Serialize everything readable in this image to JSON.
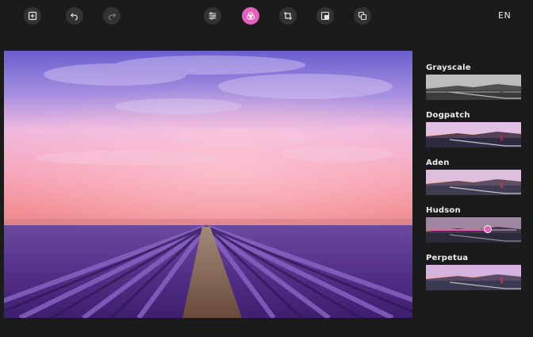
{
  "toolbar": {
    "buttons": [
      {
        "name": "add-image-button",
        "icon": "add-image-icon"
      },
      {
        "name": "undo-button",
        "icon": "undo-icon"
      },
      {
        "name": "redo-button",
        "icon": "redo-icon"
      },
      {
        "name": "adjust-button",
        "icon": "sliders-icon"
      },
      {
        "name": "filters-button",
        "icon": "filters-icon",
        "active": true
      },
      {
        "name": "crop-button",
        "icon": "crop-icon"
      },
      {
        "name": "resize-button",
        "icon": "resize-icon"
      },
      {
        "name": "overlay-button",
        "icon": "overlay-icon"
      }
    ],
    "language": "EN"
  },
  "canvas": {
    "description_icon": "photo"
  },
  "filters": [
    {
      "label": "Grayscale"
    },
    {
      "label": "Dogpatch"
    },
    {
      "label": "Aden"
    },
    {
      "label": "Hudson",
      "selected": true,
      "intensity": 0.67
    },
    {
      "label": "Perpetua"
    }
  ],
  "colors": {
    "accent": "#e75fbe",
    "background": "#1b1b1c",
    "button": "#333336"
  }
}
